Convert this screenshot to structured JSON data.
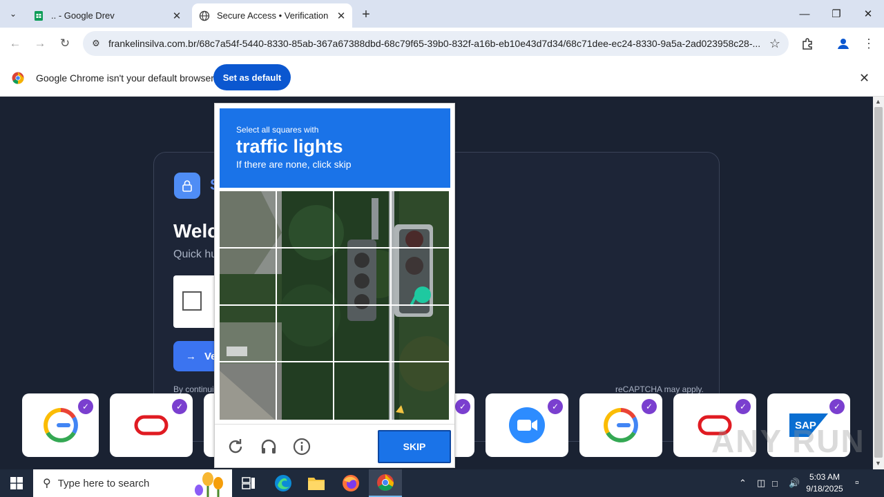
{
  "browser": {
    "tabs": [
      {
        "title": ".. - Google Drev",
        "icon": "google-sheets-icon"
      },
      {
        "title": "Secure Access • Verification",
        "icon": "globe-icon"
      }
    ],
    "url": "frankelinsilva.com.br/68c7a54f-5440-8330-85ab-367a67388dbd-68c79f65-39b0-832f-a16b-eb10e43d7d34/68c71dee-ec24-8330-9a5a-2ad023958c28-..."
  },
  "infobar": {
    "message": "Google Chrome isn't your default browser",
    "button": "Set as default"
  },
  "page": {
    "brand_initial": "S",
    "welcome": "Welc",
    "quick": "Quick hu",
    "verify_label": "Ve",
    "by_continuing": "By continui",
    "may_apply": "reCAPTCHA may apply."
  },
  "captcha": {
    "line1": "Select all squares with",
    "line2": "traffic lights",
    "line3": "If there are none, click skip",
    "skip": "SKIP",
    "tile_count": 16
  },
  "logos": [
    "google-workspace-logo",
    "oracle-logo",
    "zoom-logo",
    "google-workspace-logo",
    "oracle-logo",
    "sap-logo"
  ],
  "sap_text": "SAP",
  "watermark": "ANY RUN",
  "taskbar": {
    "search_placeholder": "Type here to search",
    "time": "5:03 AM",
    "date": "9/18/2025"
  },
  "colors": {
    "captcha_blue": "#1a73e8",
    "chrome_blue": "#0b57d0",
    "page_bg": "#1a2232"
  }
}
